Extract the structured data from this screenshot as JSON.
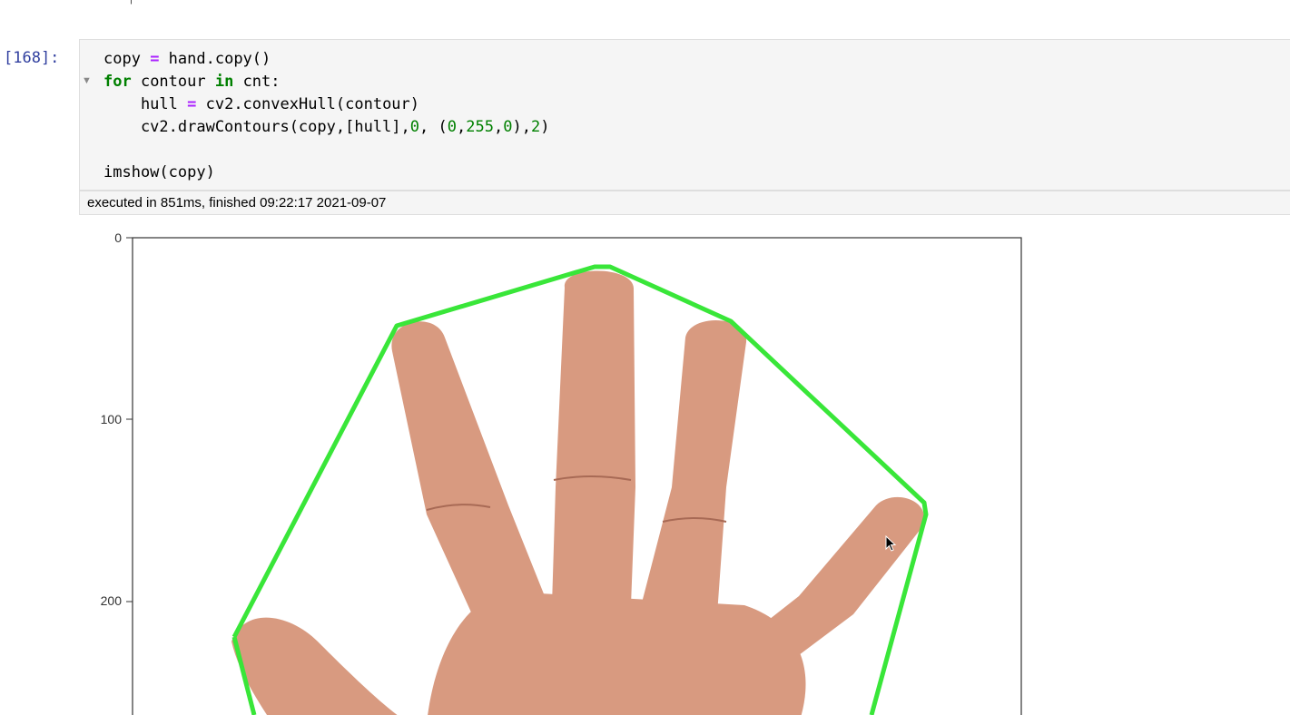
{
  "cell": {
    "prompt": "[168]:",
    "code_lines": [
      [
        {
          "t": "copy ",
          "c": ""
        },
        {
          "t": "=",
          "c": "op"
        },
        {
          "t": " hand.copy()",
          "c": ""
        }
      ],
      [
        {
          "t": "for",
          "c": "kw"
        },
        {
          "t": " contour ",
          "c": ""
        },
        {
          "t": "in",
          "c": "kw"
        },
        {
          "t": " cnt:",
          "c": ""
        }
      ],
      [
        {
          "t": "    hull ",
          "c": ""
        },
        {
          "t": "=",
          "c": "op"
        },
        {
          "t": " cv2.convexHull(contour)",
          "c": ""
        }
      ],
      [
        {
          "t": "    cv2.drawContours(copy,[hull],",
          "c": ""
        },
        {
          "t": "0",
          "c": "num"
        },
        {
          "t": ", (",
          "c": ""
        },
        {
          "t": "0",
          "c": "num"
        },
        {
          "t": ",",
          "c": ""
        },
        {
          "t": "255",
          "c": "num"
        },
        {
          "t": ",",
          "c": ""
        },
        {
          "t": "0",
          "c": "num"
        },
        {
          "t": "),",
          "c": ""
        },
        {
          "t": "2",
          "c": "num"
        },
        {
          "t": ")",
          "c": ""
        }
      ],
      [],
      [
        {
          "t": "imshow(copy)",
          "c": ""
        }
      ]
    ],
    "execution_info": "executed in 851ms, finished 09:22:17 2021-09-07"
  },
  "output": {
    "y_ticks": [
      "0",
      "100",
      "200"
    ],
    "hull_color": "#39e639",
    "skin_color": "#d89a80"
  }
}
